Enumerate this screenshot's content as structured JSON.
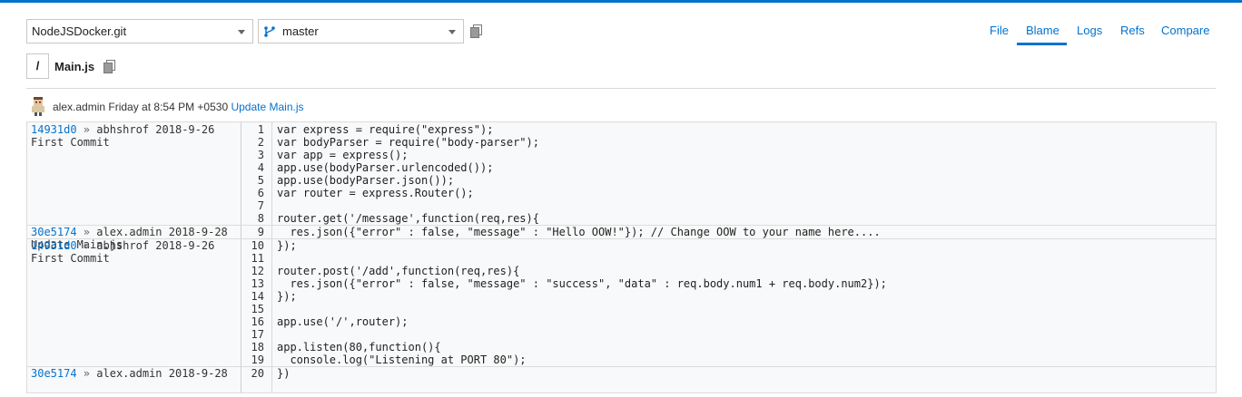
{
  "colors": {
    "accent": "#0572ce"
  },
  "repo_select": {
    "value": "NodeJSDocker.git"
  },
  "branch_select": {
    "value": "master",
    "icon": "git-branch-icon"
  },
  "tabs": [
    {
      "label": "File"
    },
    {
      "label": "Blame"
    },
    {
      "label": "Logs"
    },
    {
      "label": "Refs"
    },
    {
      "label": "Compare"
    }
  ],
  "active_tab": "Blame",
  "path": {
    "root": "/",
    "file": "Main.js"
  },
  "last_commit": {
    "author": "alex.admin",
    "time": "Friday at 8:54 PM +0530",
    "message": "Update Main.js"
  },
  "blame": [
    {
      "hash": "14931d0",
      "arrow": "»",
      "author": "abhshrof",
      "date": "2018-9-26",
      "message": "First Commit",
      "lines": [
        {
          "n": "1",
          "code": "var express = require(\"express\");"
        },
        {
          "n": "2",
          "code": "var bodyParser = require(\"body-parser\");"
        },
        {
          "n": "3",
          "code": "var app = express();"
        },
        {
          "n": "4",
          "code": "app.use(bodyParser.urlencoded());"
        },
        {
          "n": "5",
          "code": "app.use(bodyParser.json());"
        },
        {
          "n": "6",
          "code": "var router = express.Router();"
        },
        {
          "n": "7",
          "code": ""
        },
        {
          "n": "8",
          "code": "router.get('/message',function(req,res){"
        }
      ]
    },
    {
      "hash": "30e5174",
      "arrow": "»",
      "author": "alex.admin",
      "date": "2018-9-28",
      "message": "Update Main.js",
      "lines": [
        {
          "n": "9",
          "code": "  res.json({\"error\" : false, \"message\" : \"Hello OOW!\"}); // Change OOW to your name here...."
        }
      ]
    },
    {
      "hash": "14931d0",
      "arrow": "»",
      "author": "abhshrof",
      "date": "2018-9-26",
      "message": "First Commit",
      "lines": [
        {
          "n": "10",
          "code": "});"
        },
        {
          "n": "11",
          "code": ""
        },
        {
          "n": "12",
          "code": "router.post('/add',function(req,res){"
        },
        {
          "n": "13",
          "code": "  res.json({\"error\" : false, \"message\" : \"success\", \"data\" : req.body.num1 + req.body.num2});"
        },
        {
          "n": "14",
          "code": "});"
        },
        {
          "n": "15",
          "code": ""
        },
        {
          "n": "16",
          "code": "app.use('/',router);"
        },
        {
          "n": "17",
          "code": ""
        },
        {
          "n": "18",
          "code": "app.listen(80,function(){"
        },
        {
          "n": "19",
          "code": "  console.log(\"Listening at PORT 80\");"
        }
      ]
    },
    {
      "hash": "30e5174",
      "arrow": "»",
      "author": "alex.admin",
      "date": "2018-9-28",
      "message": "",
      "lines": [
        {
          "n": "20",
          "code": "})"
        }
      ]
    }
  ]
}
